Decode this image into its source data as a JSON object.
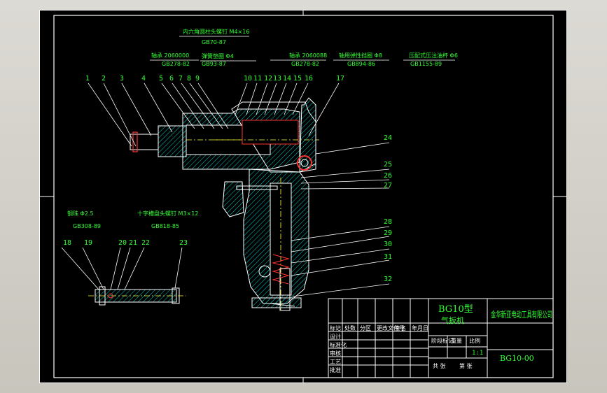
{
  "drawing": {
    "part_numbers": [
      "1",
      "2",
      "3",
      "4",
      "5",
      "6",
      "7",
      "8",
      "9",
      "10",
      "11",
      "12",
      "13",
      "14",
      "15",
      "16",
      "17",
      "18",
      "19",
      "20",
      "21",
      "22",
      "23",
      "24",
      "25",
      "26",
      "27",
      "28",
      "29",
      "30",
      "31",
      "32"
    ],
    "callouts_top": [
      {
        "name": "内六角圆柱头螺钉 M4×16",
        "std": "GB70-87"
      },
      {
        "name": "弹簧垫圈 Φ4",
        "std": "GB93-87"
      },
      {
        "name": "轴承 2060000",
        "std": "GB278-82"
      },
      {
        "name": "轴承 2060088",
        "std": "GB278-82"
      },
      {
        "name": "轴用弹性挡圈 Φ8",
        "std": "GB894-86"
      },
      {
        "name": "压配式压注油杯 Φ6",
        "std": "GB1155-89"
      }
    ],
    "callouts_side": [
      {
        "name": "钢珠 Φ2.5",
        "std": "GB308-89"
      },
      {
        "name": "十字槽盘头螺钉 M3×12",
        "std": "GB818-85"
      }
    ]
  },
  "title_block": {
    "product_name": "BG10型",
    "product_sub": "气扳机",
    "company": "金华新亚电动工具有限公司",
    "drawing_no": "BG10-00",
    "scale": "1:1",
    "row_labels": [
      "标记",
      "处数",
      "分区",
      "更改文件号",
      "签名",
      "年月日"
    ],
    "role_labels": [
      "设计",
      "标准化",
      "审核",
      "工艺",
      "批准"
    ],
    "stage_labels": [
      "阶段标记",
      "重量",
      "比例"
    ],
    "sheet_labels": [
      "共 张",
      "第 张"
    ]
  }
}
